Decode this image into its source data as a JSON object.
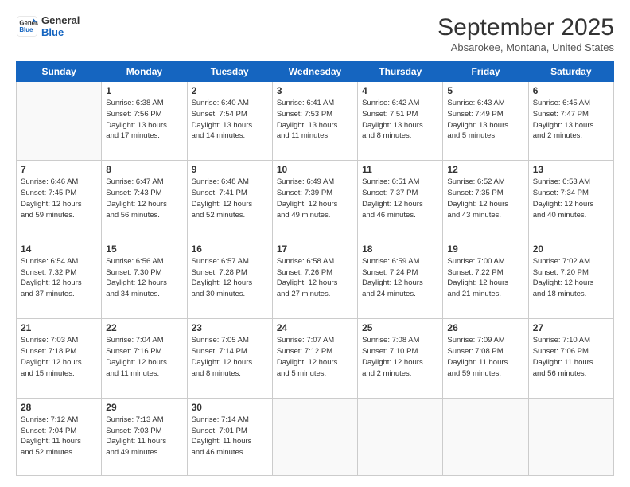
{
  "logo": {
    "line1": "General",
    "line2": "Blue"
  },
  "header": {
    "month": "September 2025",
    "location": "Absarokee, Montana, United States"
  },
  "weekdays": [
    "Sunday",
    "Monday",
    "Tuesday",
    "Wednesday",
    "Thursday",
    "Friday",
    "Saturday"
  ],
  "weeks": [
    [
      {
        "day": "",
        "info": ""
      },
      {
        "day": "1",
        "info": "Sunrise: 6:38 AM\nSunset: 7:56 PM\nDaylight: 13 hours\nand 17 minutes."
      },
      {
        "day": "2",
        "info": "Sunrise: 6:40 AM\nSunset: 7:54 PM\nDaylight: 13 hours\nand 14 minutes."
      },
      {
        "day": "3",
        "info": "Sunrise: 6:41 AM\nSunset: 7:53 PM\nDaylight: 13 hours\nand 11 minutes."
      },
      {
        "day": "4",
        "info": "Sunrise: 6:42 AM\nSunset: 7:51 PM\nDaylight: 13 hours\nand 8 minutes."
      },
      {
        "day": "5",
        "info": "Sunrise: 6:43 AM\nSunset: 7:49 PM\nDaylight: 13 hours\nand 5 minutes."
      },
      {
        "day": "6",
        "info": "Sunrise: 6:45 AM\nSunset: 7:47 PM\nDaylight: 13 hours\nand 2 minutes."
      }
    ],
    [
      {
        "day": "7",
        "info": "Sunrise: 6:46 AM\nSunset: 7:45 PM\nDaylight: 12 hours\nand 59 minutes."
      },
      {
        "day": "8",
        "info": "Sunrise: 6:47 AM\nSunset: 7:43 PM\nDaylight: 12 hours\nand 56 minutes."
      },
      {
        "day": "9",
        "info": "Sunrise: 6:48 AM\nSunset: 7:41 PM\nDaylight: 12 hours\nand 52 minutes."
      },
      {
        "day": "10",
        "info": "Sunrise: 6:49 AM\nSunset: 7:39 PM\nDaylight: 12 hours\nand 49 minutes."
      },
      {
        "day": "11",
        "info": "Sunrise: 6:51 AM\nSunset: 7:37 PM\nDaylight: 12 hours\nand 46 minutes."
      },
      {
        "day": "12",
        "info": "Sunrise: 6:52 AM\nSunset: 7:35 PM\nDaylight: 12 hours\nand 43 minutes."
      },
      {
        "day": "13",
        "info": "Sunrise: 6:53 AM\nSunset: 7:34 PM\nDaylight: 12 hours\nand 40 minutes."
      }
    ],
    [
      {
        "day": "14",
        "info": "Sunrise: 6:54 AM\nSunset: 7:32 PM\nDaylight: 12 hours\nand 37 minutes."
      },
      {
        "day": "15",
        "info": "Sunrise: 6:56 AM\nSunset: 7:30 PM\nDaylight: 12 hours\nand 34 minutes."
      },
      {
        "day": "16",
        "info": "Sunrise: 6:57 AM\nSunset: 7:28 PM\nDaylight: 12 hours\nand 30 minutes."
      },
      {
        "day": "17",
        "info": "Sunrise: 6:58 AM\nSunset: 7:26 PM\nDaylight: 12 hours\nand 27 minutes."
      },
      {
        "day": "18",
        "info": "Sunrise: 6:59 AM\nSunset: 7:24 PM\nDaylight: 12 hours\nand 24 minutes."
      },
      {
        "day": "19",
        "info": "Sunrise: 7:00 AM\nSunset: 7:22 PM\nDaylight: 12 hours\nand 21 minutes."
      },
      {
        "day": "20",
        "info": "Sunrise: 7:02 AM\nSunset: 7:20 PM\nDaylight: 12 hours\nand 18 minutes."
      }
    ],
    [
      {
        "day": "21",
        "info": "Sunrise: 7:03 AM\nSunset: 7:18 PM\nDaylight: 12 hours\nand 15 minutes."
      },
      {
        "day": "22",
        "info": "Sunrise: 7:04 AM\nSunset: 7:16 PM\nDaylight: 12 hours\nand 11 minutes."
      },
      {
        "day": "23",
        "info": "Sunrise: 7:05 AM\nSunset: 7:14 PM\nDaylight: 12 hours\nand 8 minutes."
      },
      {
        "day": "24",
        "info": "Sunrise: 7:07 AM\nSunset: 7:12 PM\nDaylight: 12 hours\nand 5 minutes."
      },
      {
        "day": "25",
        "info": "Sunrise: 7:08 AM\nSunset: 7:10 PM\nDaylight: 12 hours\nand 2 minutes."
      },
      {
        "day": "26",
        "info": "Sunrise: 7:09 AM\nSunset: 7:08 PM\nDaylight: 11 hours\nand 59 minutes."
      },
      {
        "day": "27",
        "info": "Sunrise: 7:10 AM\nSunset: 7:06 PM\nDaylight: 11 hours\nand 56 minutes."
      }
    ],
    [
      {
        "day": "28",
        "info": "Sunrise: 7:12 AM\nSunset: 7:04 PM\nDaylight: 11 hours\nand 52 minutes."
      },
      {
        "day": "29",
        "info": "Sunrise: 7:13 AM\nSunset: 7:03 PM\nDaylight: 11 hours\nand 49 minutes."
      },
      {
        "day": "30",
        "info": "Sunrise: 7:14 AM\nSunset: 7:01 PM\nDaylight: 11 hours\nand 46 minutes."
      },
      {
        "day": "",
        "info": ""
      },
      {
        "day": "",
        "info": ""
      },
      {
        "day": "",
        "info": ""
      },
      {
        "day": "",
        "info": ""
      }
    ]
  ]
}
